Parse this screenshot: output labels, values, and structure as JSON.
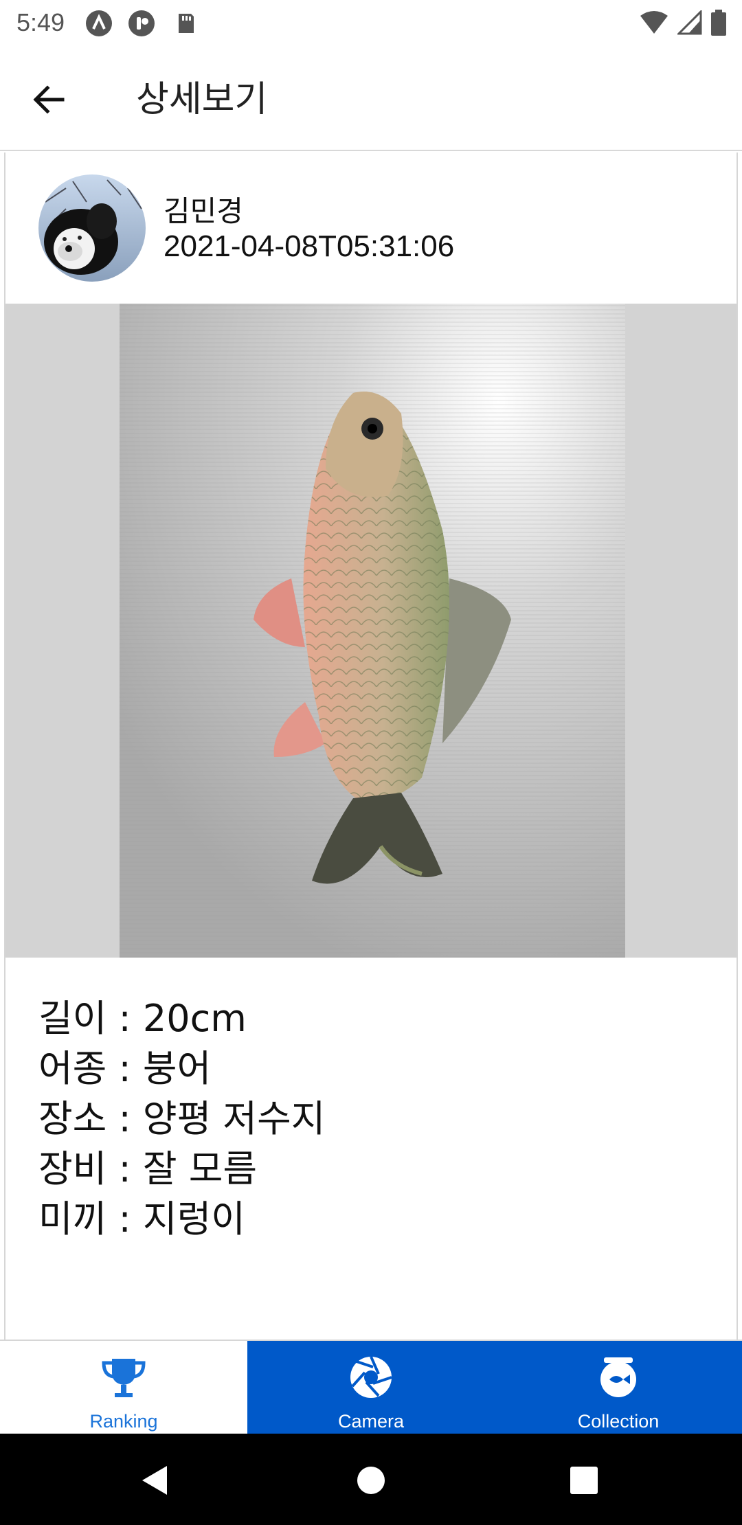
{
  "status_bar": {
    "time": "5:49",
    "left_icons": [
      "android-system-icon",
      "assistant-icon",
      "sd-card-icon"
    ],
    "right_icons": [
      "wifi-icon",
      "signal-icon",
      "battery-icon"
    ]
  },
  "app_bar": {
    "title": "상세보기",
    "back_icon": "arrow-left-icon"
  },
  "post": {
    "user_name": "김민경",
    "date": "2021-04-08T05:31:06",
    "avatar": "dog-photo-avatar",
    "photo": "crucian-carp-photo"
  },
  "details": {
    "length": "길이 : 20cm",
    "species": "어종 : 붕어",
    "location": "장소 : 양평 저수지",
    "equipment": "장비 : 잘 모름",
    "bait": "미끼 : 지렁이"
  },
  "bottom_nav": {
    "items": [
      {
        "label": "Ranking",
        "icon": "trophy-icon",
        "selected": true
      },
      {
        "label": "Camera",
        "icon": "camera-shutter-icon",
        "selected": false
      },
      {
        "label": "Collection",
        "icon": "fishbowl-icon",
        "selected": false
      }
    ]
  },
  "colors": {
    "accent": "#0059c9",
    "selected_label": "#1a73d9",
    "photo_background": "#d3d3d3"
  }
}
